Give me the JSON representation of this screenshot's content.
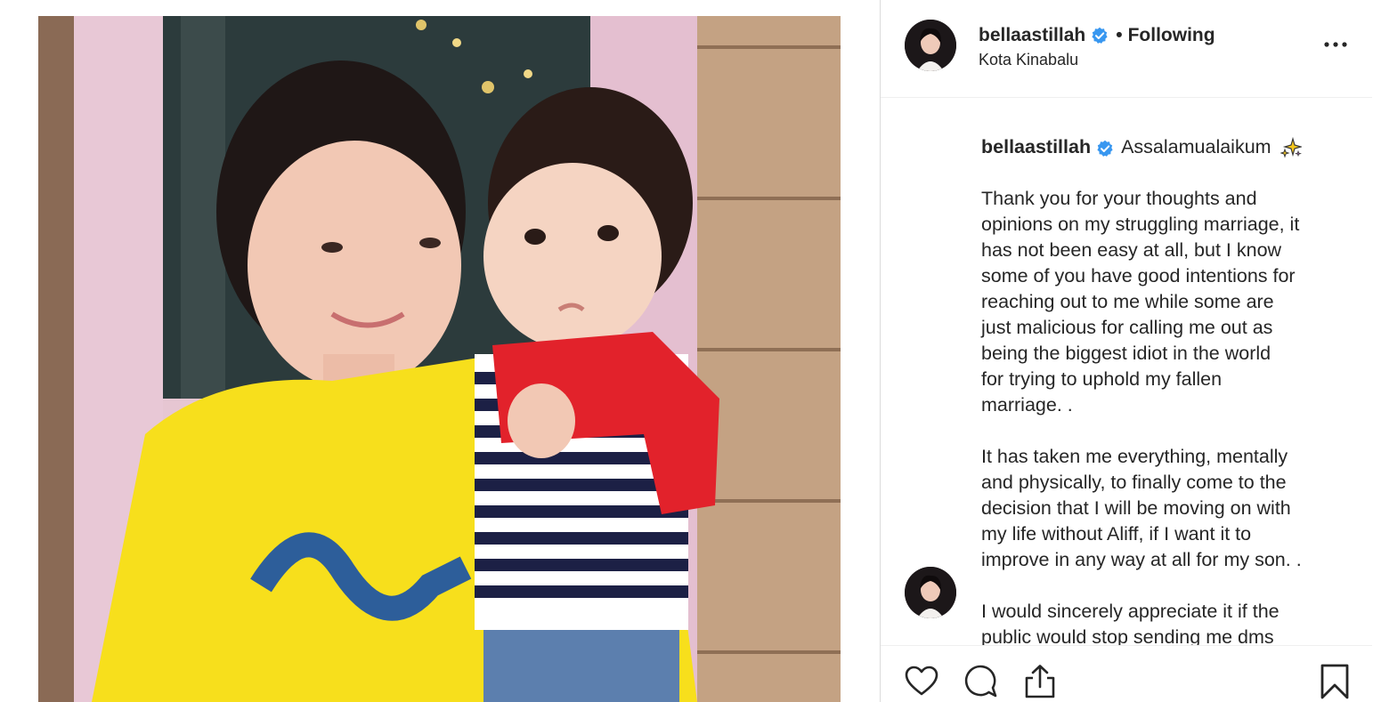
{
  "post": {
    "username": "bellaastillah",
    "follow_status": "Following",
    "separator": "•",
    "location": "Kota Kinabalu",
    "verified": true
  },
  "caption": {
    "username": "bellaastillah",
    "greeting": "Assalamualaikum",
    "greeting_emoji": "sparkles-emoji",
    "paragraphs": [
      [
        "Thank you for your thoughts and",
        "opinions on my struggling marriage, it",
        "has not been easy at all, but I know",
        "some of you have good intentions for",
        "reaching out to me while some are",
        "just malicious for calling me out as",
        "being the biggest idiot in the world",
        "for trying to uphold my fallen",
        "marriage. ."
      ],
      [
        "It has taken me everything, mentally",
        "and physically, to finally come to the",
        "decision that I will be moving on with",
        "my life without Aliff, if I want it to",
        "improve in any way at all for my son. ."
      ],
      [
        "I would sincerely appreciate it if the",
        "public would stop sending me dms"
      ]
    ]
  },
  "actions": {
    "like_icon": "heart-icon",
    "comment_icon": "comment-icon",
    "share_icon": "share-icon",
    "save_icon": "bookmark-icon",
    "more_icon": "ellipsis-icon"
  },
  "colors": {
    "text": "#262626",
    "verified_blue": "#3897f0",
    "divider": "#efefef"
  }
}
